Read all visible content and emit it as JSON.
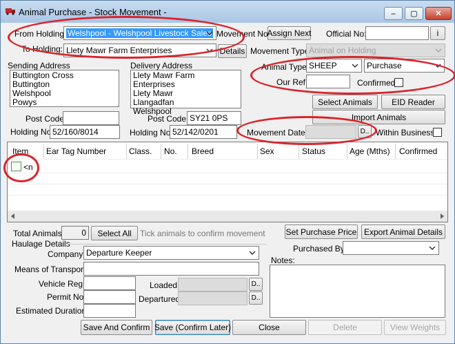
{
  "window": {
    "title": "Animal Purchase - Stock Movement -",
    "minimize_label": "–",
    "restore_label": "▢",
    "close_label": "✕"
  },
  "holding": {
    "from_label": "From Holding:",
    "from_value": "Welshpool - Welshpool Livestock Sales",
    "to_label": "To Holding:",
    "to_value": "Llety Mawr Farm Enterprises",
    "details_button": "Details"
  },
  "movement": {
    "no_label": "Movement No:",
    "assign_next_button": "Assign Next",
    "official_no_label": "Official No:",
    "official_no_value": "",
    "info_button": "i",
    "type_label": "Movement Type:",
    "type_value": "Animal on Holding",
    "date_label": "Movement Date:",
    "date_value": "",
    "date_button": "D..",
    "within_business_label": "Within Business"
  },
  "animal": {
    "type_label": "Animal Type:",
    "type_value": "SHEEP",
    "purchase_value": "Purchase",
    "our_ref_label": "Our Ref:",
    "our_ref_value": "",
    "confirmed_label": "Confirmed:"
  },
  "sending": {
    "label": "Sending Address",
    "lines": [
      "Buttington Cross",
      "Buttington",
      "Welshpool",
      "Powys"
    ],
    "postcode_label": "Post Code:",
    "postcode_value": "",
    "holding_no_label": "Holding No:",
    "holding_no_value": "52/160/8014"
  },
  "delivery": {
    "label": "Delivery Address",
    "lines": [
      "Llety Mawr Farm Enterprises",
      "Llety Mawr",
      "Llangadfan",
      "Welshpool"
    ],
    "postcode_label": "Post Code:",
    "postcode_value": "SY21 0PS",
    "holding_no_label": "Holding No:",
    "holding_no_value": "52/142/0201"
  },
  "actions": {
    "select_animals": "Select Animals",
    "eid_reader": "EID Reader",
    "import_animals": "Import Animals"
  },
  "grid": {
    "columns": [
      "Item",
      "Ear Tag Number",
      "Class.",
      "No.",
      "Breed",
      "Sex",
      "Status",
      "Age (Mths)",
      "Confirmed"
    ],
    "new_row_text": "<n"
  },
  "totals": {
    "total_animals_label": "Total Animals:",
    "total_animals_value": "0",
    "select_all_button": "Select All",
    "tick_hint": "Tick animals to confirm movement",
    "set_purchase_price_button": "Set Purchase Price",
    "export_animal_details_button": "Export Animal Details"
  },
  "haulage": {
    "section_label": "Haulage Details",
    "company_label": "Company:",
    "company_value": "Departure Keeper",
    "transport_label": "Means of Transport:",
    "vehicle_reg_label": "Vehicle Reg:",
    "permit_no_label": "Permit No:",
    "duration_label": "Estimated Duration:",
    "loaded_label": "Loaded:",
    "departured_label": "Departured:",
    "date_button": "D.."
  },
  "purchase": {
    "purchased_by_label": "Purchased By:",
    "purchased_by_value": "",
    "notes_label": "Notes:"
  },
  "footer": {
    "save_confirm": "Save And Confirm",
    "save_confirm_later": "Save (Confirm Later)",
    "close": "Close",
    "delete": "Delete",
    "view_weights": "View Weights"
  }
}
